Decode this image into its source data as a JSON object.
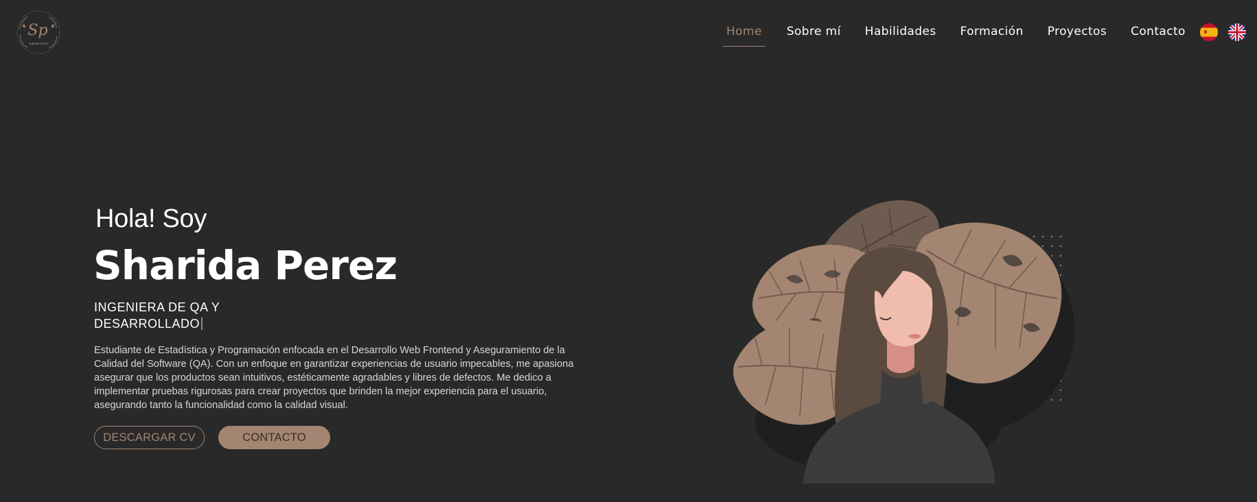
{
  "header": {
    "logo": {
      "monogram": "Sp",
      "caption": "SHARIDA PEREZ"
    },
    "nav": [
      {
        "label": "Home",
        "active": true
      },
      {
        "label": "Sobre mí",
        "active": false
      },
      {
        "label": "Habilidades",
        "active": false
      },
      {
        "label": "Formación",
        "active": false
      },
      {
        "label": "Proyectos",
        "active": false
      },
      {
        "label": "Contacto",
        "active": false
      }
    ],
    "languages": [
      {
        "icon": "spain-flag-icon"
      },
      {
        "icon": "uk-flag-icon"
      }
    ]
  },
  "hero": {
    "greeting": "Hola! Soy",
    "name": "Sharida Perez",
    "role": "INGENIERA DE QA Y DESARROLLADO",
    "bio": "Estudiante de Estadística y Programación enfocada en el Desarrollo Web Frontend y Aseguramiento de la Calidad del Software (QA). Con un enfoque en garantizar experiencias de usuario impecables, me apasiona asegurar que los productos sean intuitivos, estéticamente agradables y libres de defectos. Me dedico a implementar pruebas rigurosas para crear proyectos que brinden la mejor experiencia para el usuario, asegurando tanto la funcionalidad como la calidad visual.",
    "buttons": {
      "download_cv": "DESCARGAR CV",
      "contact": "CONTACTO"
    }
  },
  "colors": {
    "background": "#292929",
    "accent": "#a38571",
    "text": "#ffffff",
    "leaf_light": "#a38571",
    "leaf_dark": "#6e5c50",
    "circle": "#1f1f1f"
  }
}
